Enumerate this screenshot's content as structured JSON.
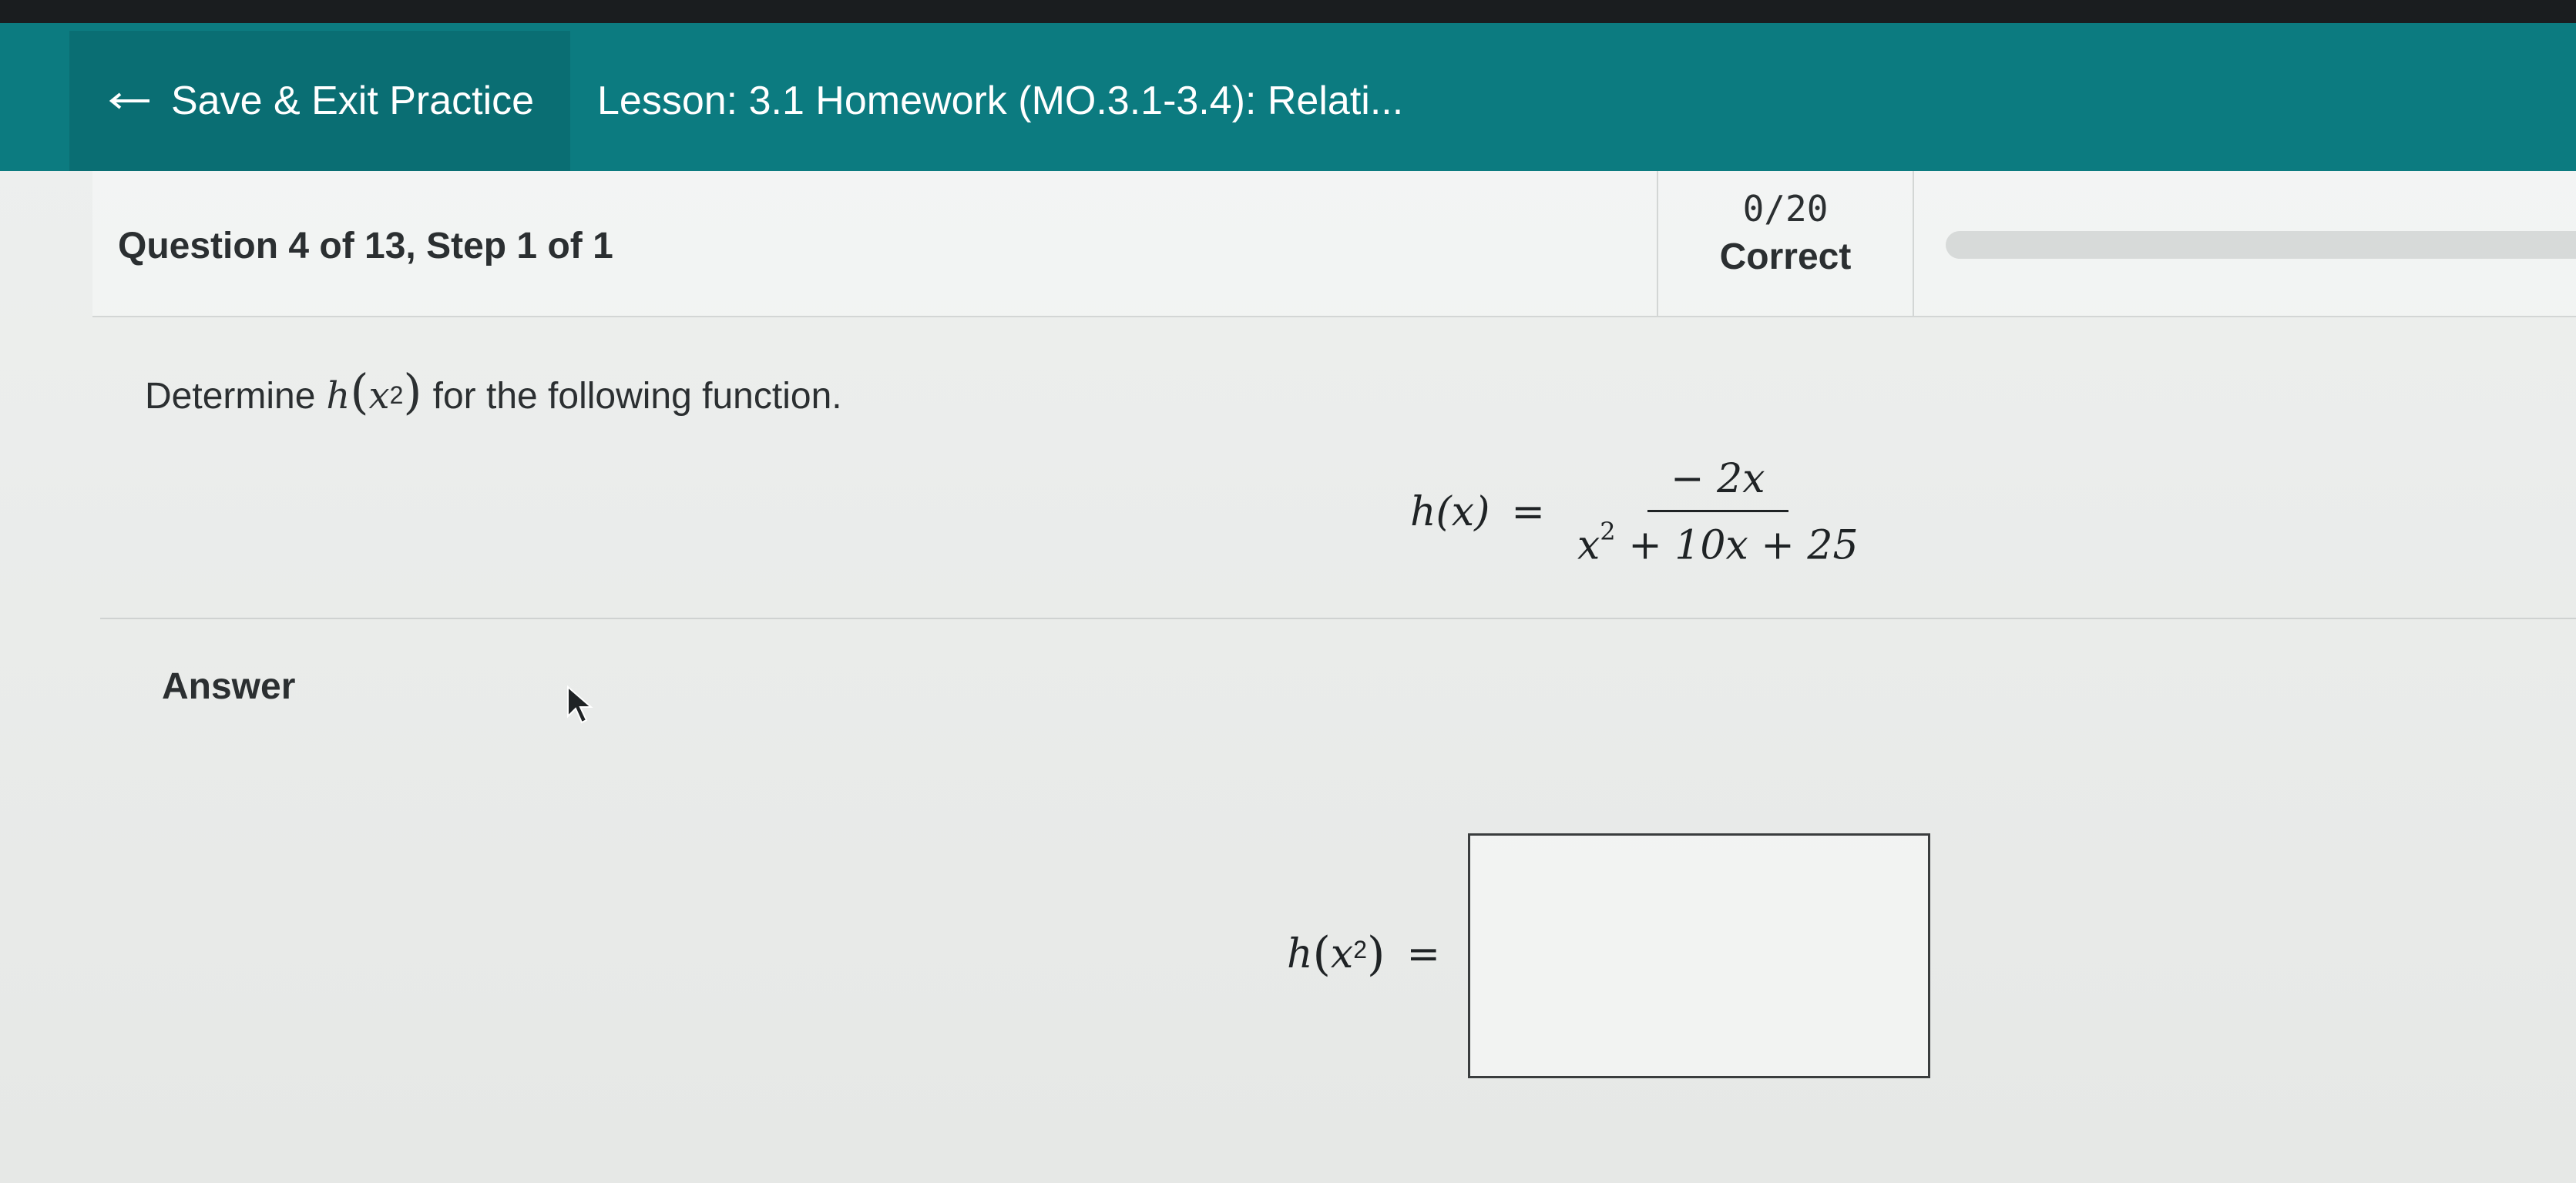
{
  "topbar": {
    "save_exit_label": "Save & Exit Practice",
    "lesson_title": "Lesson: 3.1 Homework (MO.3.1-3.4): Relati...",
    "color": "#0c7b80"
  },
  "question_header": {
    "label": "Question 4 of 13,  Step 1 of 1",
    "score": "0/20",
    "score_label": "Correct"
  },
  "question": {
    "prompt_prefix": "Determine",
    "prompt_function": "h",
    "prompt_argument": "x",
    "prompt_exponent": "2",
    "prompt_suffix": "for the following function.",
    "equation_lhs": "h(x)",
    "equals": "=",
    "numerator": "− 2x",
    "denominator_term1_base": "x",
    "denominator_term1_exp": "2",
    "denominator_rest": "+ 10x + 25"
  },
  "answer": {
    "label": "Answer",
    "lhs_function": "h",
    "lhs_argument": "x",
    "lhs_exponent": "2",
    "equals": "=",
    "input_value": ""
  }
}
